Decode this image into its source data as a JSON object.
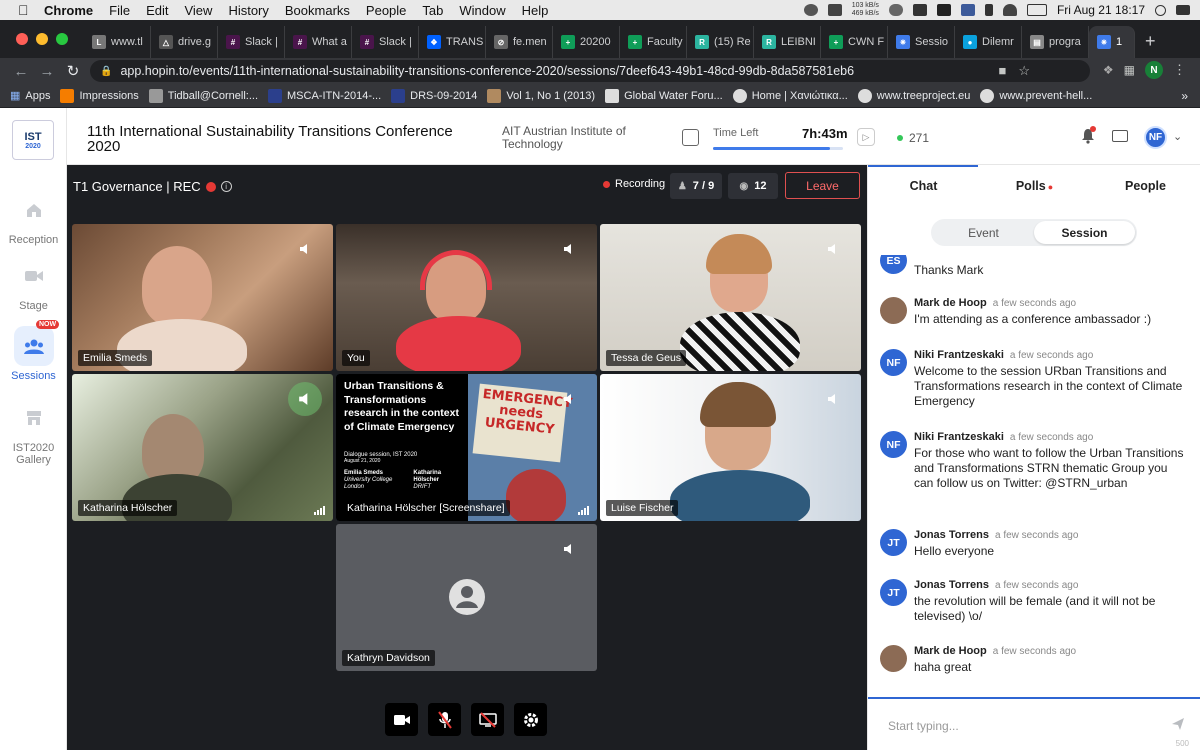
{
  "os_menubar": {
    "app_name": "Chrome",
    "items": [
      "File",
      "Edit",
      "View",
      "History",
      "Bookmarks",
      "People",
      "Tab",
      "Window",
      "Help"
    ],
    "net_up": "103 kB/s",
    "net_down": "469 kB/s",
    "datetime": "Fri Aug 21  18:17"
  },
  "browser": {
    "tabs": [
      {
        "label": "www.tl",
        "fav": "L",
        "color": "#777"
      },
      {
        "label": "drive.g",
        "fav": "△",
        "color": "#555"
      },
      {
        "label": "Slack |",
        "fav": "#",
        "color": "#4a154b"
      },
      {
        "label": "What a",
        "fav": "#",
        "color": "#4a154b"
      },
      {
        "label": "Slack |",
        "fav": "#",
        "color": "#4a154b"
      },
      {
        "label": "TRANS",
        "fav": "❖",
        "color": "#0061ff"
      },
      {
        "label": "fe.men",
        "fav": "⊘",
        "color": "#666"
      },
      {
        "label": "20200",
        "fav": "+",
        "color": "#0f9d58"
      },
      {
        "label": "Faculty",
        "fav": "+",
        "color": "#0f9d58"
      },
      {
        "label": "(15) Re",
        "fav": "R",
        "color": "#2cb5a0"
      },
      {
        "label": "LEIBNI",
        "fav": "R",
        "color": "#2cb5a0"
      },
      {
        "label": "CWN F",
        "fav": "+",
        "color": "#0f9d58"
      },
      {
        "label": "Sessio",
        "fav": "✷",
        "color": "#3f7bea"
      },
      {
        "label": "Dilemr",
        "fav": "●",
        "color": "#0aa1dd"
      },
      {
        "label": "progra",
        "fav": "▤",
        "color": "#888"
      },
      {
        "label": "1",
        "fav": "✷",
        "color": "#3f7bea",
        "active": true
      }
    ],
    "url": "app.hopin.to/events/11th-international-sustainability-transitions-conference-2020/sessions/7deef643-49b1-48cd-99db-8da587581eb6",
    "profile_initial": "N",
    "bookmarks": [
      "Apps",
      "Impressions",
      "Tidball@Cornell:...",
      "MSCA-ITN-2014-...",
      "DRS-09-2014",
      "Vol 1, No 1 (2013)",
      "Global Water Foru...",
      "Home | Χανιώτικα...",
      "www.treeproject.eu",
      "www.prevent-hell..."
    ]
  },
  "sidebar": {
    "logo_text": "IST",
    "logo_year": "2020",
    "items": [
      {
        "label": "Reception",
        "icon": "home-icon"
      },
      {
        "label": "Stage",
        "icon": "camera-icon"
      },
      {
        "label": "Sessions",
        "icon": "people-icon",
        "badge": "NOW",
        "active": true
      },
      {
        "label": "IST2020 Gallery",
        "icon": "gallery-icon"
      }
    ]
  },
  "header": {
    "event_title": "11th International Sustainability Transitions Conference 2020",
    "organizer": "AIT Austrian Institute of Technology",
    "time_left_label": "Time Left",
    "time_left_value": "7h:43m",
    "time_left_progress": 0.9,
    "online_count": "271",
    "user_initials": "NF"
  },
  "session": {
    "room_name": "T1 Governance | REC",
    "recording_label": "Recording",
    "participants": "7 / 9",
    "viewers": "12",
    "leave_label": "Leave",
    "tiles": [
      {
        "name": "Emilia Smeds"
      },
      {
        "name": "You"
      },
      {
        "name": "Tessa de Geus"
      },
      {
        "name": "Katharina Hölscher",
        "speaking": true
      },
      {
        "name": "Katharina Hölscher [Screenshare]"
      },
      {
        "name": "Luise Fischer"
      },
      {
        "name": "Kathryn Davidson"
      }
    ],
    "slide": {
      "title": "Urban Transitions & Transformations research in the context of Climate Emergency",
      "subtitle": "Dialogue session, IST 2020",
      "date": "August 21, 2020",
      "author1_name": "Emilia Smeds",
      "author1_org": "University College London",
      "author2_name": "Katharina Hölscher",
      "author2_org": "DRIFT",
      "sign_text": "EMERGENCY needs URGENCY"
    }
  },
  "panel": {
    "tabs": [
      "Chat",
      "Polls",
      "People"
    ],
    "segment": [
      "Event",
      "Session"
    ],
    "messages": [
      {
        "initials": "ES",
        "name": "",
        "time": "",
        "text": "Thanks Mark",
        "photo": false
      },
      {
        "initials": "",
        "name": "Mark de Hoop",
        "time": "a few seconds ago",
        "text": "I'm attending as a conference ambassador :)",
        "photo": true
      },
      {
        "initials": "NF",
        "name": "Niki Frantzeskaki",
        "time": "a few seconds ago",
        "text": "Welcome to the session URban Transitions and Transformations research in the context of Climate Emergency",
        "photo": false
      },
      {
        "initials": "NF",
        "name": "Niki Frantzeskaki",
        "time": "a few seconds ago",
        "text": "For those who want to follow the Urban Transitions and Transformations STRN thematic Group you can follow us on Twitter: @STRN_urban",
        "photo": false
      },
      {
        "initials": "JT",
        "name": "Jonas Torrens",
        "time": "a few seconds ago",
        "text": "Hello everyone",
        "photo": false
      },
      {
        "initials": "JT",
        "name": "Jonas Torrens",
        "time": "a few seconds ago",
        "text": "the revolution will be female (and it will not be televised) \\o/",
        "photo": false
      },
      {
        "initials": "",
        "name": "Mark de Hoop",
        "time": "a few seconds ago",
        "text": "haha great",
        "photo": true
      }
    ],
    "compose_placeholder": "Start typing...",
    "char_limit": "500"
  }
}
